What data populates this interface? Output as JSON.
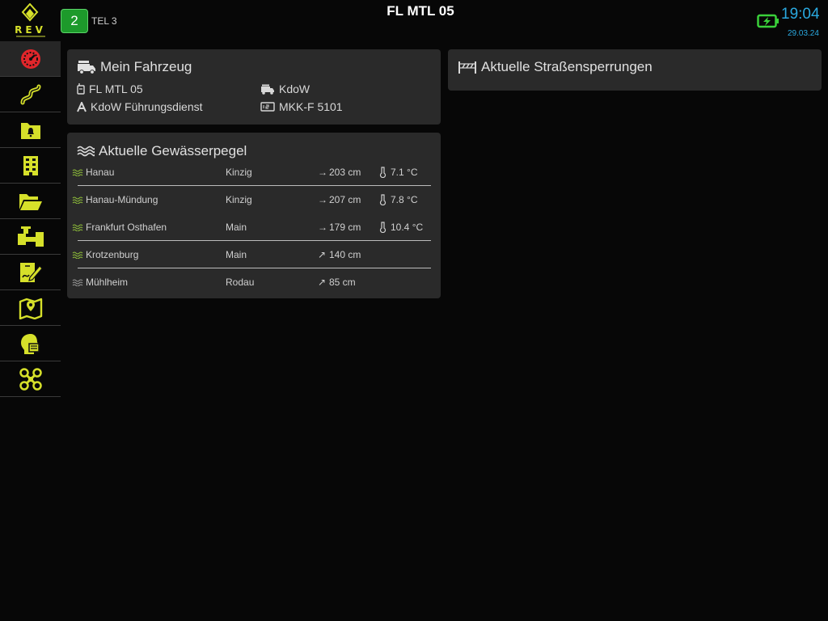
{
  "app": {
    "logo_text": "REV",
    "title": "FL MTL 05",
    "badge_count": "2",
    "tel_label": "TEL 3",
    "clock": "19:04",
    "date": "29.03.24",
    "accent_color": "#d6e02a",
    "clock_color": "#2aa9e0",
    "battery_icon": "battery-charging-icon"
  },
  "sidebar": {
    "items": [
      {
        "icon": "dashboard-icon",
        "active": true
      },
      {
        "icon": "route-icon"
      },
      {
        "icon": "alarm-folder-icon"
      },
      {
        "icon": "building-icon"
      },
      {
        "icon": "open-folder-icon"
      },
      {
        "icon": "hydrant-icon"
      },
      {
        "icon": "edit-document-icon"
      },
      {
        "icon": "map-icon"
      },
      {
        "icon": "person-icon"
      },
      {
        "icon": "drone-icon"
      }
    ]
  },
  "vehicle": {
    "title": "Mein Fahrzeug",
    "radio_name": "FL MTL 05",
    "type": "KdoW",
    "function": "KdoW Führungsdienst",
    "plate": "MKK-F 5101"
  },
  "water": {
    "title": "Aktuelle Gewässerpegel",
    "rows": [
      {
        "station": "Hanau",
        "river": "Kinzig",
        "trend": "→",
        "level": "203 cm",
        "temp": "7.1 °C"
      },
      {
        "station": "Hanau-Mündung",
        "river": "Kinzig",
        "trend": "→",
        "level": "207 cm",
        "temp": "7.8 °C"
      },
      {
        "station": "Frankfurt Osthafen",
        "river": "Main",
        "trend": "→",
        "level": "179 cm",
        "temp": "10.4 °C"
      },
      {
        "station": "Krotzenburg",
        "river": "Main",
        "trend": "↗",
        "level": "140 cm",
        "temp": ""
      },
      {
        "station": "Mühlheim",
        "river": "Rodau",
        "trend": "↗",
        "level": "85 cm",
        "temp": ""
      }
    ]
  },
  "closures": {
    "title": "Aktuelle Straßensperrungen"
  }
}
